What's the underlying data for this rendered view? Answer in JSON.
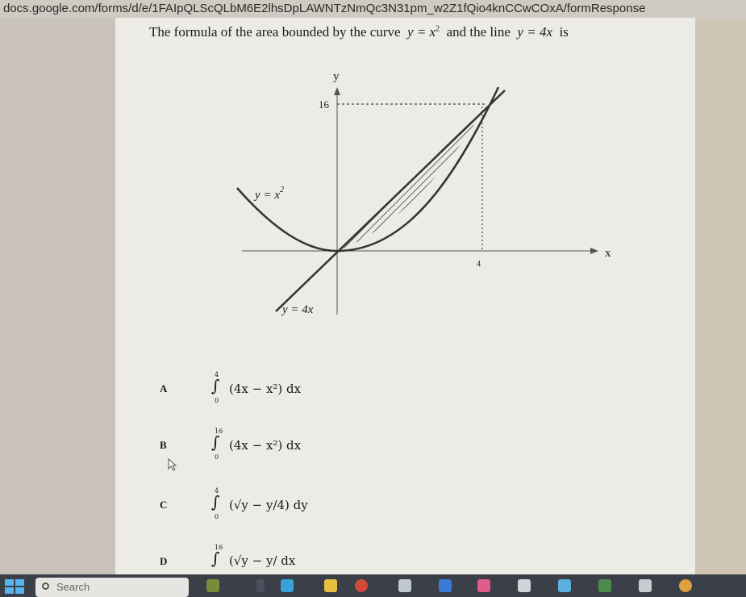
{
  "browser": {
    "url": "docs.google.com/forms/d/e/1FAIpQLScQLbM6E2lhsDpLAWNTzNmQc3N31pm_w2Z1fQio4knCCwCOxA/formResponse"
  },
  "question": {
    "prefix": "The formula of the area bounded by the curve",
    "curve": "y = x",
    "curve_exp": "2",
    "middle": "and the line",
    "line": "y = 4x",
    "suffix": "is"
  },
  "graph": {
    "y_axis_label": "y",
    "x_axis_label": "x",
    "y_tick": "16",
    "x_tick": "4",
    "curve_label": "y = x",
    "curve_label_exp": "2",
    "line_label": "y = 4x"
  },
  "options": [
    {
      "letter": "A",
      "upper": "4",
      "lower": "0",
      "expr": "(4x − x²) dx"
    },
    {
      "letter": "B",
      "upper": "16",
      "lower": "0",
      "expr": "(4x − x²) dx"
    },
    {
      "letter": "C",
      "upper": "4",
      "lower": "0",
      "expr": "(√y − y/4) dy"
    },
    {
      "letter": "D",
      "upper": "16",
      "lower": "",
      "expr": "(√y − y/ dx"
    }
  ],
  "taskbar": {
    "search_placeholder": "Search"
  },
  "colors": {
    "paper": "#ecebe5",
    "ink": "#1a1a1a",
    "taskbar": "#3a3f48"
  }
}
